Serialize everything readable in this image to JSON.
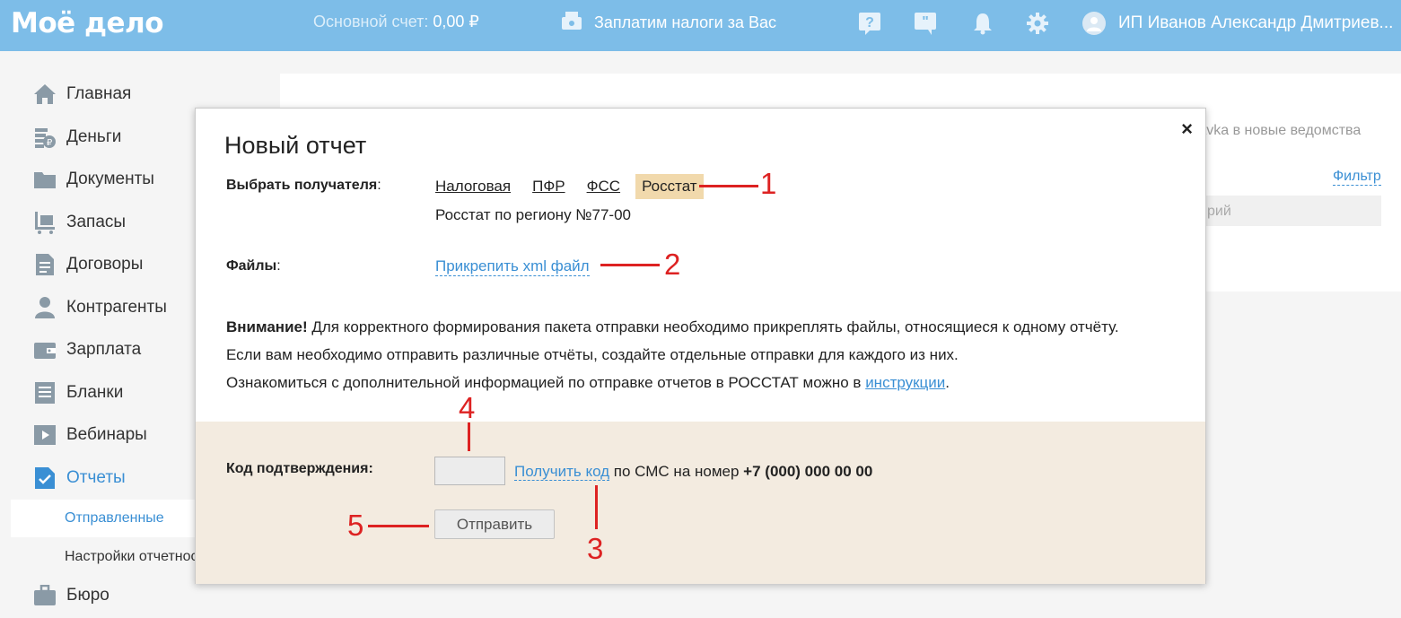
{
  "header": {
    "logo": "Моё дело",
    "account_label": "Основной счет:",
    "account_value": "0,00 ₽",
    "taxes_label": "Заплатим налоги за Вас",
    "user_name": "ИП Иванов Александр Дмитриев..."
  },
  "sidebar": {
    "items": [
      {
        "label": "Главная",
        "icon": "home-icon"
      },
      {
        "label": "Деньги",
        "icon": "money-icon"
      },
      {
        "label": "Документы",
        "icon": "folder-icon"
      },
      {
        "label": "Запасы",
        "icon": "cart-icon"
      },
      {
        "label": "Договоры",
        "icon": "contract-icon"
      },
      {
        "label": "Контрагенты",
        "icon": "person-icon"
      },
      {
        "label": "Зарплата",
        "icon": "wallet-icon"
      },
      {
        "label": "Бланки",
        "icon": "forms-icon"
      },
      {
        "label": "Вебинары",
        "icon": "video-icon"
      },
      {
        "label": "Отчеты",
        "icon": "report-icon"
      },
      {
        "label": "Бюро",
        "icon": "briefcase-icon"
      }
    ],
    "sub_items": [
      {
        "label": "Отправленные"
      },
      {
        "label": "Настройки отчетности"
      }
    ]
  },
  "background": {
    "text": "ravka в новые ведомства",
    "filter": "Фильтр",
    "input_text": "рий"
  },
  "modal": {
    "title": "Новый отчет",
    "close": "×",
    "recipient_label": "Выбрать получателя",
    "recipient_colon": ":",
    "tabs": [
      "Налоговая",
      "ПФР",
      "ФСС",
      "Росстат"
    ],
    "selected_tab": "Росстат",
    "region": "Росстат по региону №77-00",
    "files_label": "Файлы",
    "files_colon": ":",
    "attach": "Прикрепить xml файл",
    "warning_bold": "Внимание!",
    "warning_text": "Для корректного формирования пакета отправки необходимо прикреплять файлы, относящиеся к одному отчёту.",
    "warning_line2": "Если вам необходимо отправить различные отчёты, создайте отдельные отправки для каждого из них.",
    "info_prefix": "Ознакомиться с дополнительной информацией по отправке отчетов в РОССТАТ можно в ",
    "info_link": "инструкции",
    "info_suffix": ".",
    "code_label": "Код подтверждения:",
    "code_value": "",
    "get_code": "Получить код",
    "sms_text": " по СМС на номер ",
    "phone": "+7 (000) 000 00 00",
    "send": "Отправить"
  },
  "annotations": [
    "1",
    "2",
    "3",
    "4",
    "5"
  ],
  "colors": {
    "header_bg": "#7dbde8",
    "accent": "#3a8fd4",
    "selected_tab": "#f1d9ac",
    "footer_bg": "#f3ebe0",
    "annotation": "#d22"
  }
}
